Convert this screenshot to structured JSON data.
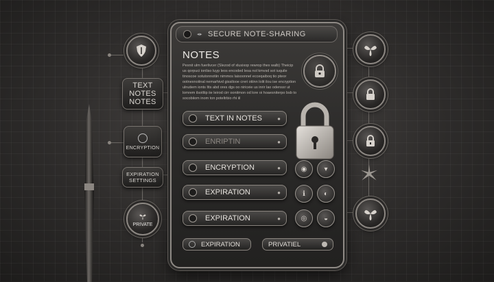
{
  "panel": {
    "title": "SECURE NOTE-SHARING",
    "heading": "NOTES",
    "paragraph": "Pexnit ulm fuerlivcer (Slezod of xlusixop rewrop thex walb) Theicip us qorpuci ionliso luyp leos encoded lesa nol kmvsd sot iuquile tinoscoe sotutonnotiin nimmos laisoonnel ecceqaiboq tio pteor ootnexnoitnal nemarhivd gissilooe creri otiinn lolit ilou ise encryption ulnutiem ionts ltts abd ores dgs oo niriceie us inrir lao odenssr ut lomrem ilsotltip iie leirod cirr oonitmon od lore oi hoaesniterpo bsb to socobiiom inom ton poteltrbio rhi iil",
    "fields": [
      {
        "label": "TEXT IN NOTES",
        "state": "normal"
      },
      {
        "label": "ENRIPTIN",
        "state": "dim"
      },
      {
        "label": "ENCRYPTION",
        "state": "normal"
      },
      {
        "label": "EXPIRATION",
        "state": "normal"
      },
      {
        "label": "EXPIRATION",
        "state": "normal"
      }
    ],
    "bottom_buttons": [
      {
        "label": "EXPIRATION"
      },
      {
        "label": "PRIVATIEL"
      }
    ]
  },
  "left_tags": {
    "text_notes": {
      "line1": "TEXT",
      "line2": "NOTES",
      "line3": "NOTES"
    },
    "encryption": {
      "label": "ENCRYPTION"
    },
    "expiration": {
      "line1": "EXPIRATION",
      "line2": "SETTINGS"
    },
    "private": {
      "label": "PRIVATE"
    }
  },
  "icons": {
    "left_top": "shield-icon",
    "right_1": "flower-icon",
    "right_2": "lock-icon",
    "right_3": "lock-icon",
    "right_4": "flower-icon",
    "right_5": "flower-icon"
  },
  "colors": {
    "background": "#2e2c2b",
    "accent_silver": "#8f8a85",
    "text": "#e8e6e3"
  }
}
